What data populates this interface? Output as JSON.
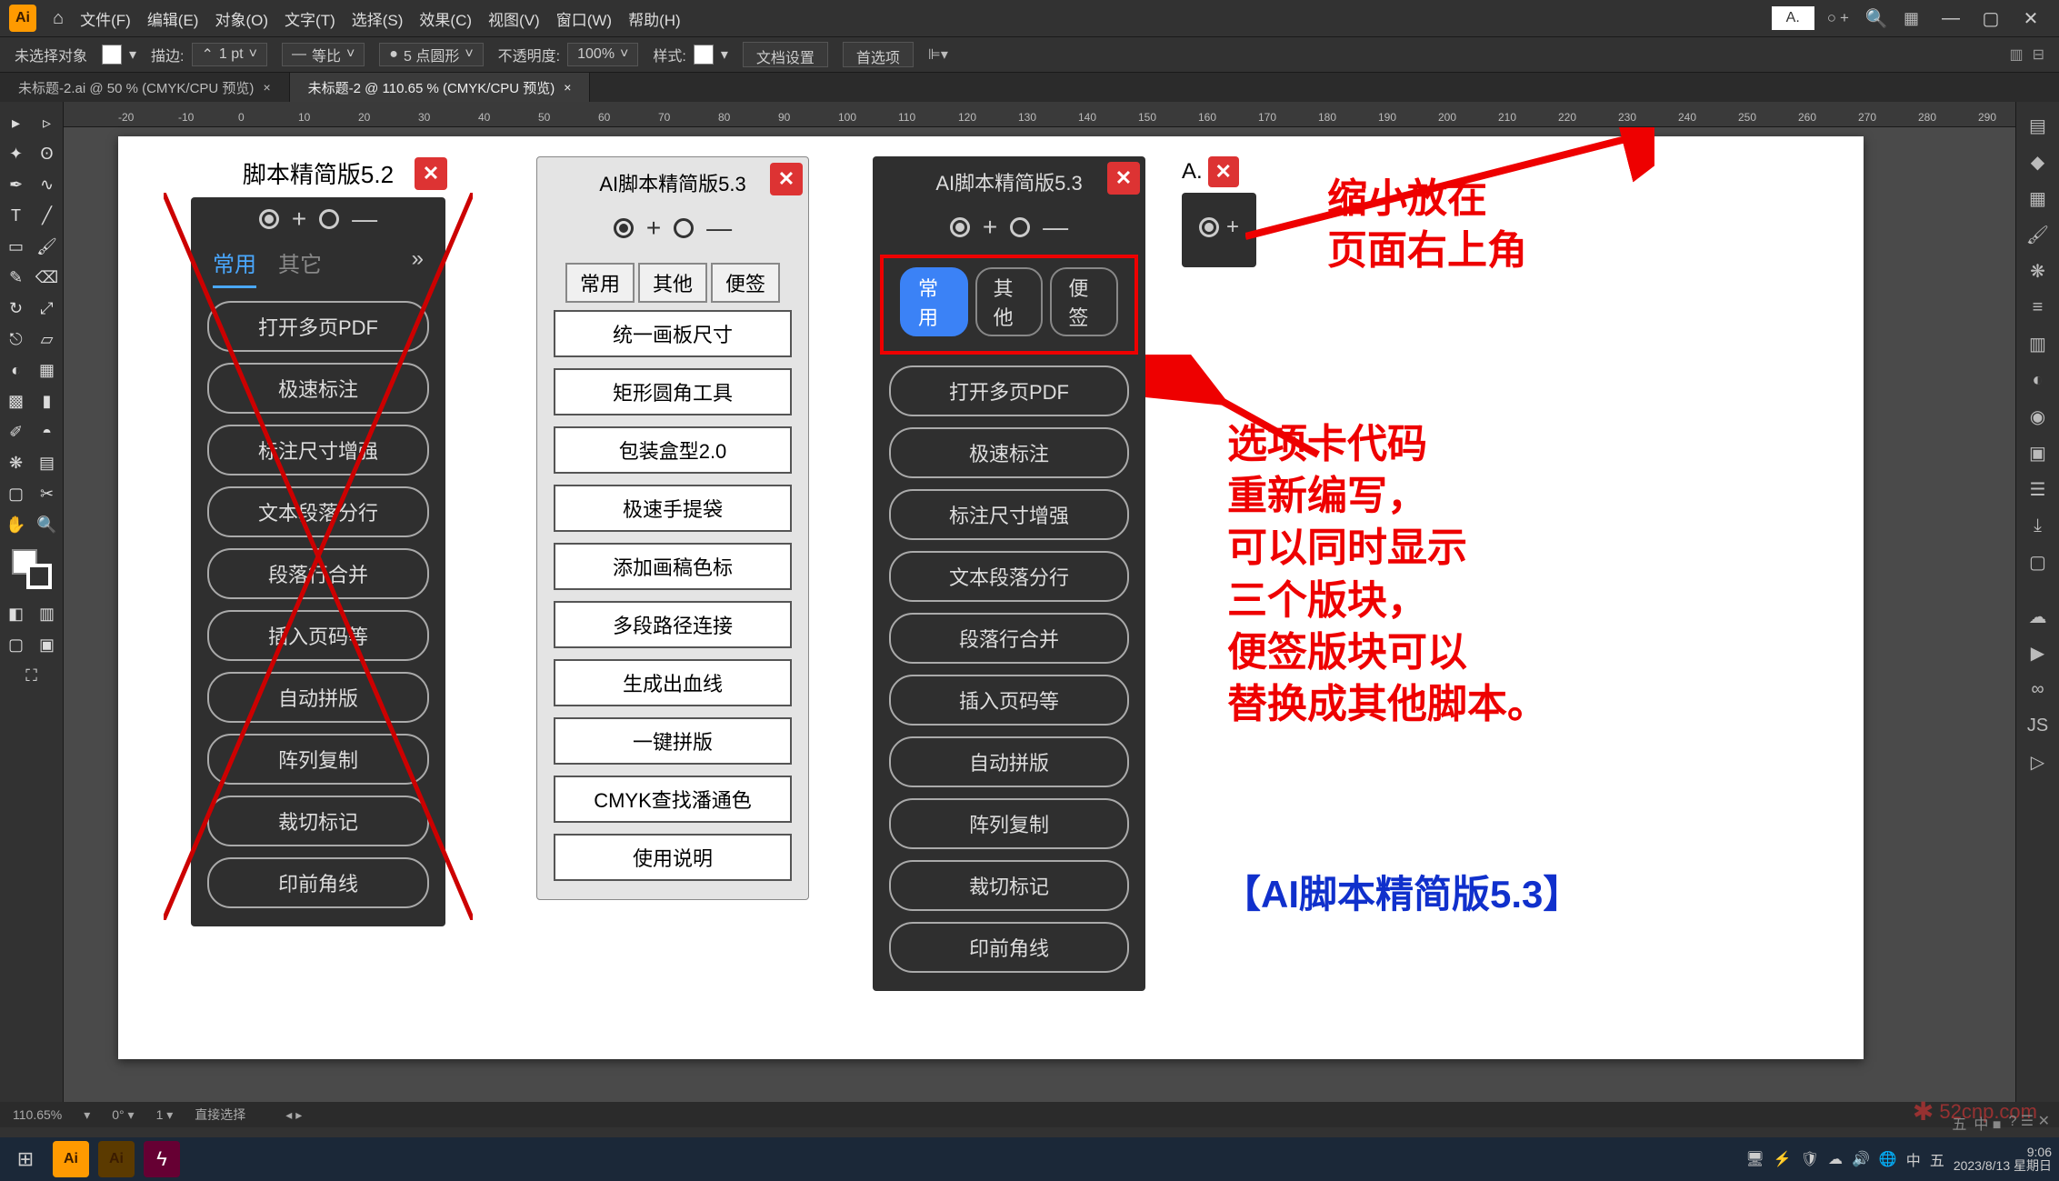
{
  "menubar": {
    "items": [
      "文件(F)",
      "编辑(E)",
      "对象(O)",
      "文字(T)",
      "选择(S)",
      "效果(C)",
      "视图(V)",
      "窗口(W)",
      "帮助(H)"
    ],
    "mini_label": "A."
  },
  "optbar": {
    "noselect": "未选择对象",
    "stroke_label": "描边:",
    "stroke_val": "1 pt",
    "uniform": "等比",
    "brush": "5 点圆形",
    "opacity_label": "不透明度:",
    "opacity_val": "100%",
    "style_label": "样式:",
    "doc_setup": "文档设置",
    "prefs": "首选项"
  },
  "tabs": {
    "t1": "未标题-2.ai @ 50 % (CMYK/CPU 预览)",
    "t2": "未标题-2 @ 110.65 % (CMYK/CPU 预览)"
  },
  "panel52": {
    "title": "脚本精简版5.2",
    "tabs": [
      "常用",
      "其它"
    ],
    "buttons": [
      "打开多页PDF",
      "极速标注",
      "标注尺寸增强",
      "文本段落分行",
      "段落行合并",
      "插入页码等",
      "自动拼版",
      "阵列复制",
      "裁切标记",
      "印前角线"
    ]
  },
  "panel53_light": {
    "title": "AI脚本精简版5.3",
    "tabs": [
      "常用",
      "其他",
      "便签"
    ],
    "buttons": [
      "统一画板尺寸",
      "矩形圆角工具",
      "包装盒型2.0",
      "极速手提袋",
      "添加画稿色标",
      "多段路径连接",
      "生成出血线",
      "一键拼版",
      "CMYK查找潘通色",
      "使用说明"
    ]
  },
  "panel53_dark": {
    "title": "AI脚本精简版5.3",
    "tabs": [
      "常用",
      "其他",
      "便签"
    ],
    "buttons": [
      "打开多页PDF",
      "极速标注",
      "标注尺寸增强",
      "文本段落分行",
      "段落行合并",
      "插入页码等",
      "自动拼版",
      "阵列复制",
      "裁切标记",
      "印前角线"
    ]
  },
  "panel_mini": {
    "title": "A."
  },
  "anno1": "缩小放在\n页面右上角",
  "anno2": "选项卡代码\n重新编写，\n可以同时显示\n三个版块，\n便签版块可以\n替换成其他脚本。",
  "anno3": "【AI脚本精简版5.3】",
  "statusbar": {
    "zoom": "110.65%",
    "mode": "直接选择"
  },
  "taskbar": {
    "time": "9:06",
    "date": "2023/8/13 星期日",
    "ime": "五",
    "ime2": "中"
  },
  "watermark": "52cnp.com",
  "ruler_ticks": [
    "-20",
    "-10",
    "0",
    "10",
    "20",
    "30",
    "40",
    "50",
    "60",
    "70",
    "80",
    "90",
    "100",
    "110",
    "120",
    "130",
    "140",
    "150",
    "160",
    "170",
    "180",
    "190",
    "200",
    "210",
    "220",
    "230",
    "240",
    "250",
    "260",
    "270",
    "280",
    "290"
  ]
}
